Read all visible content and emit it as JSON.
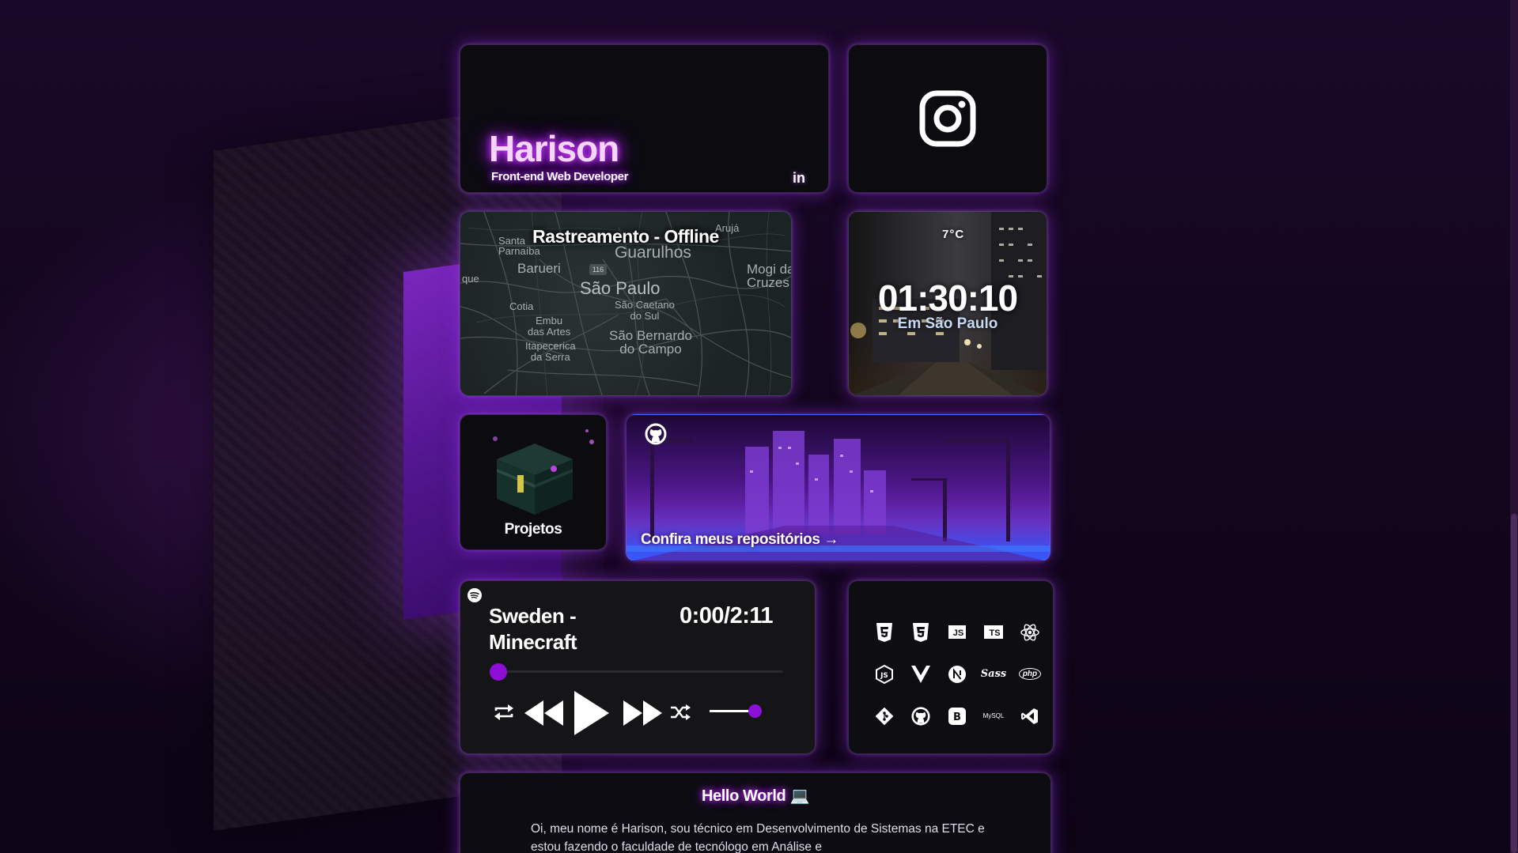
{
  "profile": {
    "name": "Harison",
    "role": "Front-end Web Developer",
    "linkedin_label": "in"
  },
  "instagram": {
    "icon": "instagram-icon"
  },
  "map": {
    "title": "Rastreamento - Offline",
    "route_shield": "116",
    "cities": {
      "santa_parnaiba": "Santa\nParnaíba",
      "aruja": "Arujá",
      "guarulhos": "Guarulhos",
      "barueri": "Barueri",
      "mogi": "Mogi da\nCruzes",
      "que": "que",
      "sao_paulo": "São Paulo",
      "cotia": "Cotia",
      "sao_caetano": "São Caetano\ndo Sul",
      "embu": "Embu\ndas Artes",
      "sao_bernardo": "São Bernardo\ndo Campo",
      "itapecerica": "Itapecerica\nda Serra"
    }
  },
  "clock": {
    "temperature": "7°C",
    "time": "01:30:10",
    "location": "Em São Paulo"
  },
  "projects": {
    "label": "Projetos"
  },
  "github": {
    "cta": "Confira meus repositórios →"
  },
  "player": {
    "track": "Sweden - Minecraft",
    "timer": "0:00/2:11",
    "progress": 0,
    "volume": 1
  },
  "techs": {
    "items": [
      "HTML5",
      "CSS3",
      "JS",
      "TS",
      "React",
      "Node.js",
      "Vue",
      "Next.js",
      "Sass",
      "php",
      "Git",
      "GitHub",
      "Bootstrap",
      "MySQL",
      "VS Code"
    ],
    "labels": {
      "js": "JS",
      "ts": "TS",
      "php": "php",
      "mysql": "MySQL",
      "sass": "Sass"
    }
  },
  "about": {
    "title": "Hello World",
    "title_emoji": "💻",
    "text": "Oi, meu nome é Harison, sou técnico em Desenvolvimento de Sistemas na ETEC e estou fazendo o faculdade de tecnólogo em Análise e"
  },
  "colors": {
    "accent": "#8b0fd6",
    "glow": "#b020ff",
    "card_bg": "#0b0b10"
  }
}
